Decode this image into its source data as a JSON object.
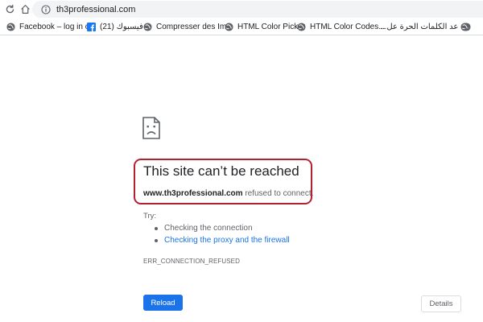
{
  "browser": {
    "url": "th3professional.com"
  },
  "bookmarks": [
    {
      "label": "Facebook – log in o...",
      "icon": "globe-icon",
      "rtl": false
    },
    {
      "label": "فيسبوك (21)",
      "icon": "facebook-icon",
      "rtl": true
    },
    {
      "label": "Compresser des Im...",
      "icon": "globe-icon",
      "rtl": false
    },
    {
      "label": "HTML Color Picker",
      "icon": "globe-icon",
      "rtl": false
    },
    {
      "label": "HTML Color Codes...",
      "icon": "globe-icon",
      "rtl": false
    },
    {
      "label": "عد الكلمات الحرة عل...",
      "icon": "globe-icon",
      "rtl": true
    }
  ],
  "error": {
    "title": "This site can’t be reached",
    "domain": "www.th3professional.com",
    "message": "refused to connect.",
    "try_label": "Try:",
    "suggestions": [
      {
        "text": "Checking the connection",
        "link": false
      },
      {
        "text": "Checking the proxy and the firewall",
        "link": true
      }
    ],
    "code": "ERR_CONNECTION_REFUSED"
  },
  "buttons": {
    "reload": "Reload",
    "details": "Details"
  },
  "colors": {
    "accent": "#1a73e8",
    "highlight_border": "#b3202e",
    "facebook": "#1877f2"
  }
}
